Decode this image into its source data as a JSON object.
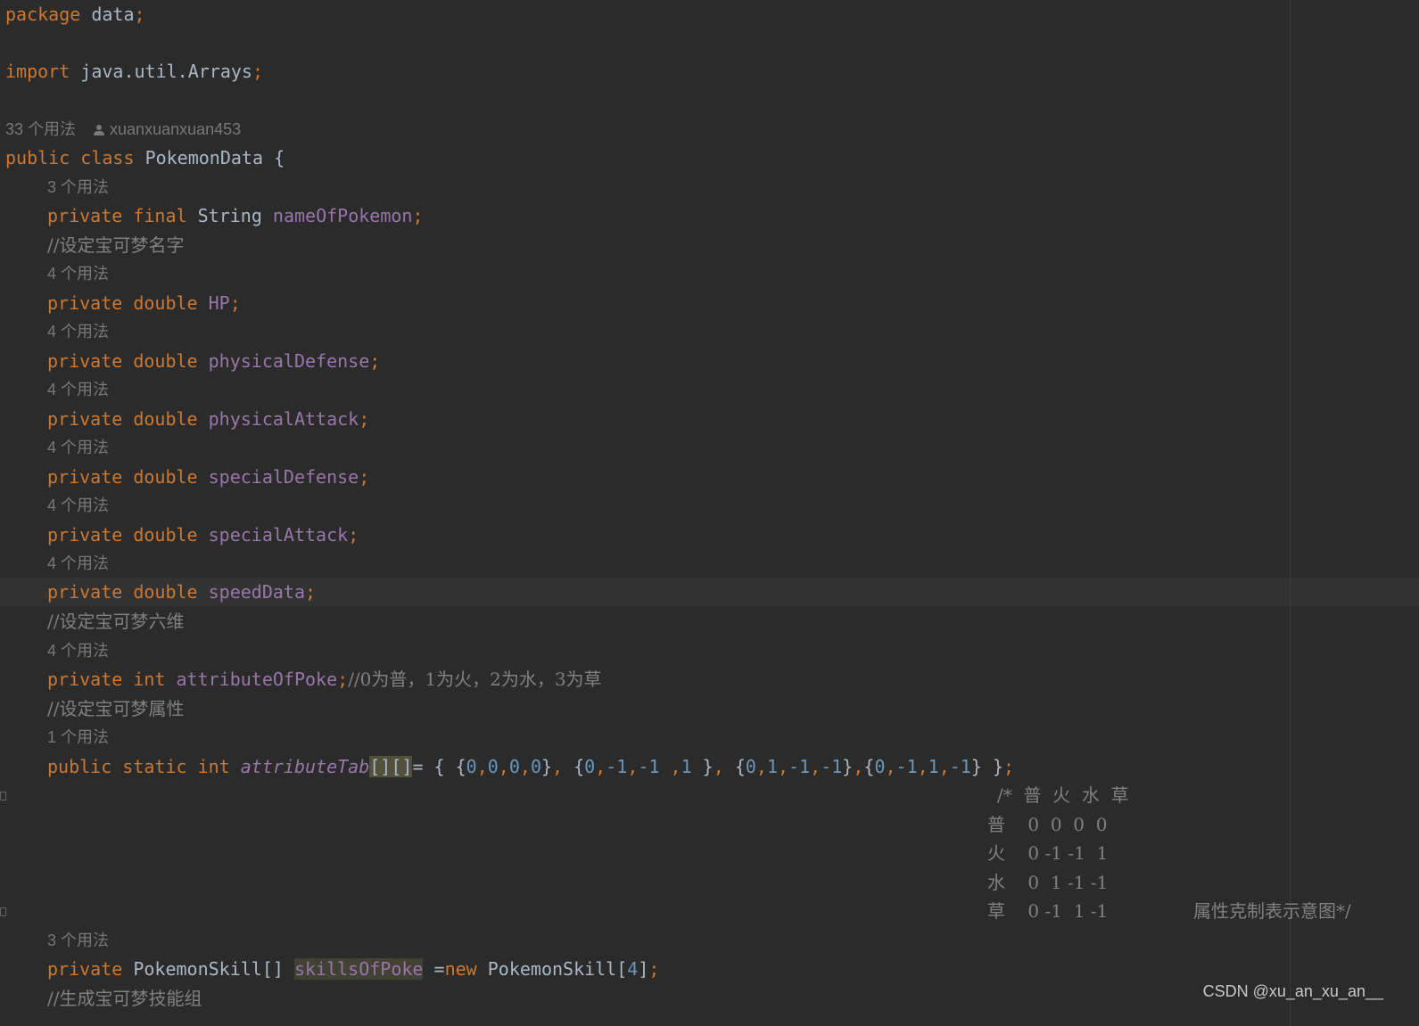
{
  "code": {
    "package_kw": "package",
    "package_name": "data",
    "semi": ";",
    "import_kw": "import",
    "import_path": "java.util.Arrays",
    "class_usages": "33 个用法",
    "class_author": "xuanxuanxuan453",
    "class_public": "public",
    "class_kw": "class",
    "class_name": "PokemonData",
    "open_brace": "{",
    "kw_private": "private",
    "kw_final": "final",
    "kw_double": "double",
    "kw_int": "int",
    "kw_static": "static",
    "kw_public": "public",
    "type_string": "String",
    "usages_3": "3 个用法",
    "usages_4": "4 个用法",
    "usages_1": "1 个用法",
    "field_name": "nameOfPokemon",
    "comment_name": "//设定宝可梦名字",
    "field_hp": "HP",
    "field_physicalDefense": "physicalDefense",
    "field_physicalAttack": "physicalAttack",
    "field_specialDefense": "specialDefense",
    "field_specialAttack": "specialAttack",
    "field_speedData": "speedData",
    "comment_six": "//设定宝可梦六维",
    "field_attribute": "attributeOfPoke",
    "comment_attribute_inline": "//0为普，1为火，2为水，3为草",
    "comment_attribute": "//设定宝可梦属性",
    "field_attributeTab": "attributeTab",
    "brackets": "[][]",
    "table_comment": {
      "header": "/*  普  火  水  草",
      "row_normal": "普    0  0  0  0",
      "row_fire": "火    0 -1 -1  1",
      "row_water": "水    0  1 -1 -1",
      "row_grass": "草    0 -1  1 -1",
      "footer": "属性克制表示意图*/"
    },
    "type_skill_array": "PokemonSkill[]",
    "field_skills": "skillsOfPoke",
    "kw_new": "new",
    "type_skill": "PokemonSkill",
    "skill_size": "4",
    "comment_skill": "//生成宝可梦技能组"
  },
  "watermark": "CSDN @xu_an_xu_an__",
  "colors": {
    "background": "#2b2b2b",
    "keyword": "#cc7832",
    "field": "#9876aa",
    "number": "#6897bb",
    "comment": "#808080",
    "text": "#a9b7c6"
  }
}
